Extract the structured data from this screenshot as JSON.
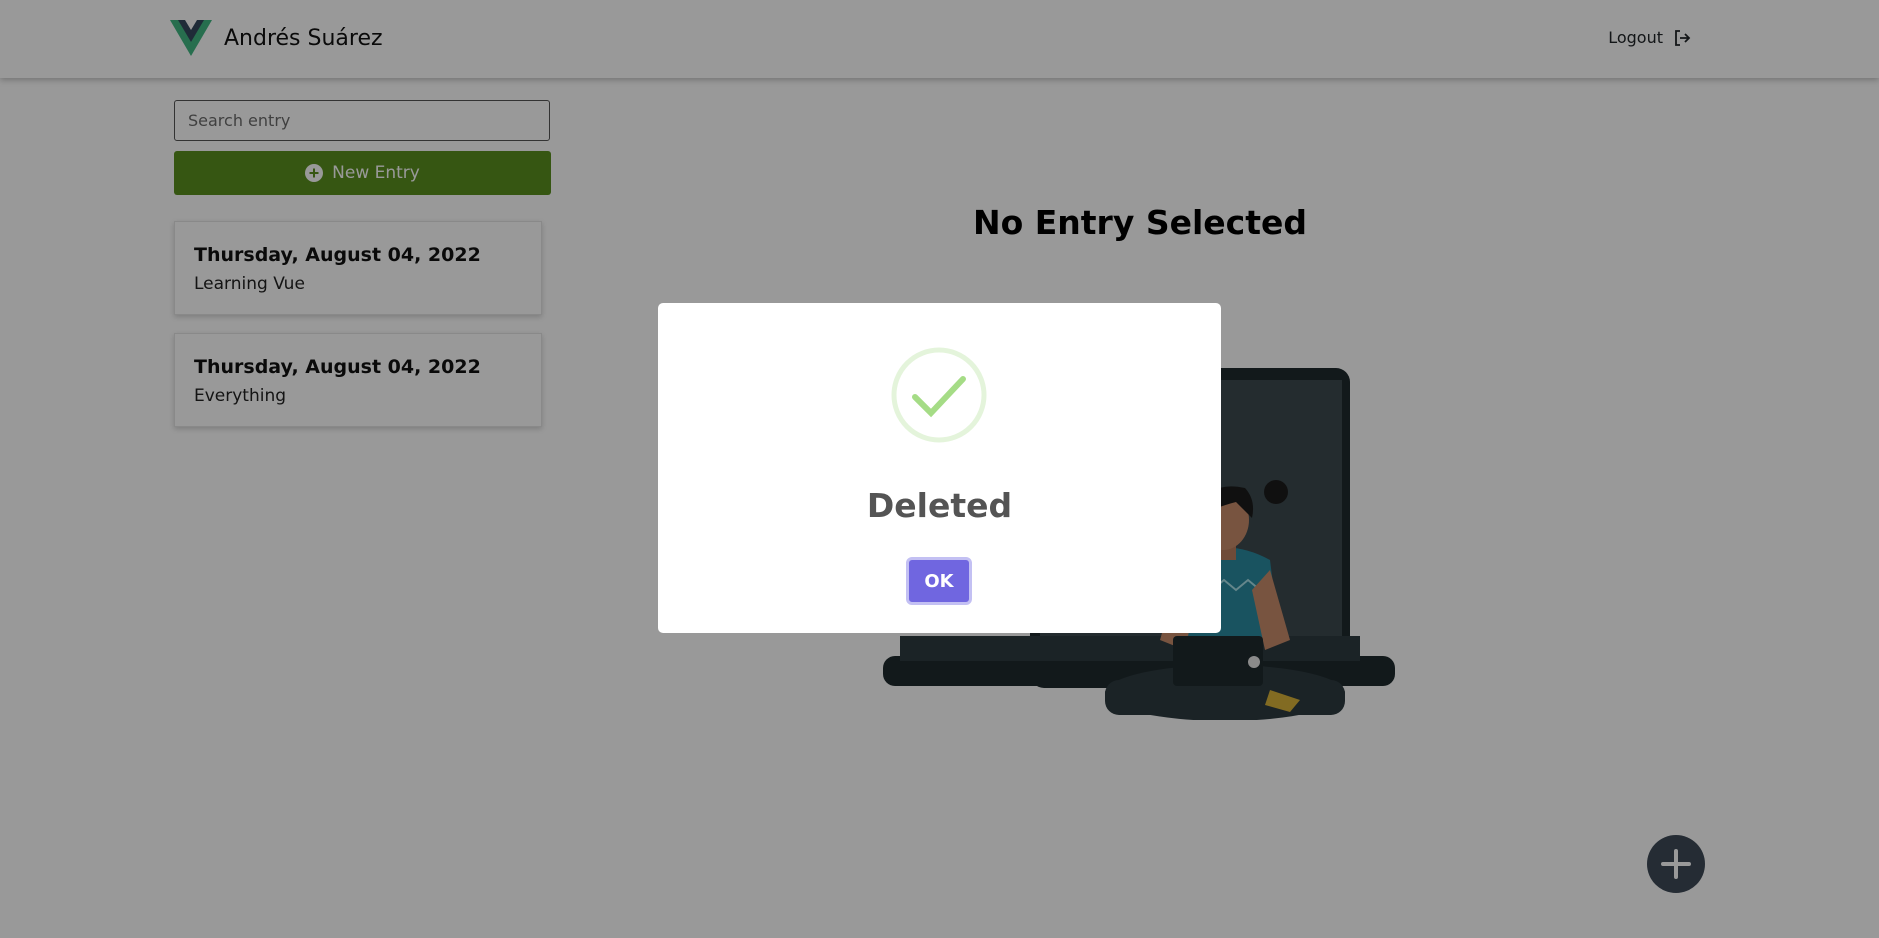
{
  "header": {
    "brand_name": "Andrés Suárez",
    "brand_icon": "vue-logo-icon",
    "logout_label": "Logout",
    "logout_icon": "logout-icon"
  },
  "sidebar": {
    "search_placeholder": "Search entry",
    "search_value": "",
    "new_entry_label": "New Entry",
    "new_entry_icon": "plus-circle-icon",
    "entries": [
      {
        "date": "Thursday, August 04, 2022",
        "text": "Learning Vue"
      },
      {
        "date": "Thursday, August 04, 2022",
        "text": "Everything"
      }
    ]
  },
  "main": {
    "title": "No Entry Selected",
    "fab_icon": "plus-icon"
  },
  "modal": {
    "icon": "success-check-icon",
    "title": "Deleted",
    "ok_label": "OK"
  },
  "colors": {
    "new_entry_bg": "#5a901e",
    "fab_bg": "#3e4a57",
    "ok_bg": "#7066e0",
    "success_green": "#a5dc86",
    "overlay": "rgba(0,0,0,0.4)"
  }
}
